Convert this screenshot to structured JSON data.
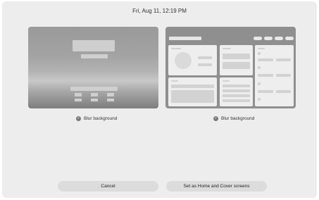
{
  "status_bar": {
    "datetime": "Fri, Aug 11, 12:19 PM"
  },
  "previews": {
    "cover": {
      "option_label": "Blur background",
      "checked": true
    },
    "home": {
      "option_label": "Blur background",
      "checked": true
    }
  },
  "icons": {
    "check": "✓"
  },
  "actions": {
    "cancel_label": "Cancel",
    "apply_label": "Set as Home and Cover screens"
  }
}
